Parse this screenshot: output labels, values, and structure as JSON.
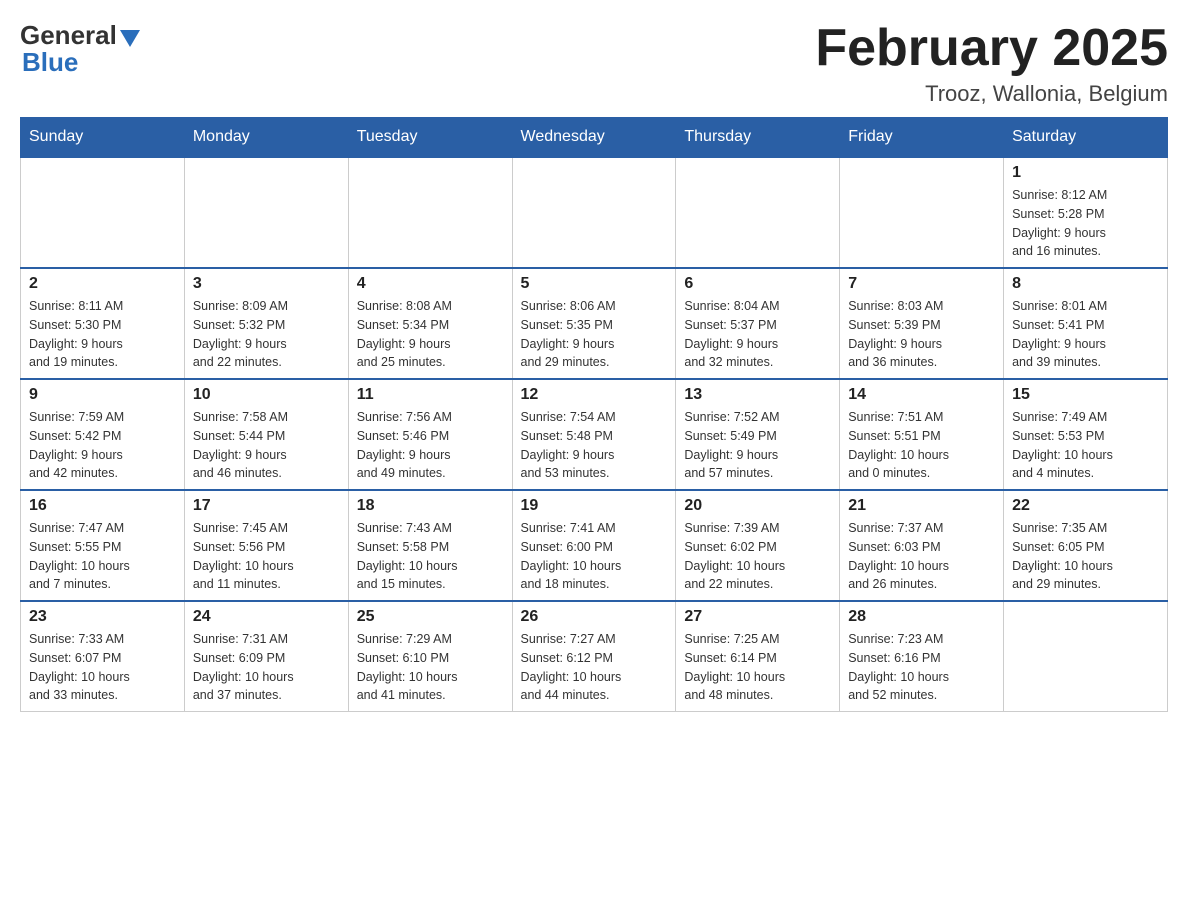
{
  "header": {
    "logo_general": "General",
    "logo_blue": "Blue",
    "month_title": "February 2025",
    "location": "Trooz, Wallonia, Belgium"
  },
  "weekdays": [
    "Sunday",
    "Monday",
    "Tuesday",
    "Wednesday",
    "Thursday",
    "Friday",
    "Saturday"
  ],
  "weeks": [
    {
      "days": [
        {
          "num": "",
          "info": ""
        },
        {
          "num": "",
          "info": ""
        },
        {
          "num": "",
          "info": ""
        },
        {
          "num": "",
          "info": ""
        },
        {
          "num": "",
          "info": ""
        },
        {
          "num": "",
          "info": ""
        },
        {
          "num": "1",
          "info": "Sunrise: 8:12 AM\nSunset: 5:28 PM\nDaylight: 9 hours\nand 16 minutes."
        }
      ]
    },
    {
      "days": [
        {
          "num": "2",
          "info": "Sunrise: 8:11 AM\nSunset: 5:30 PM\nDaylight: 9 hours\nand 19 minutes."
        },
        {
          "num": "3",
          "info": "Sunrise: 8:09 AM\nSunset: 5:32 PM\nDaylight: 9 hours\nand 22 minutes."
        },
        {
          "num": "4",
          "info": "Sunrise: 8:08 AM\nSunset: 5:34 PM\nDaylight: 9 hours\nand 25 minutes."
        },
        {
          "num": "5",
          "info": "Sunrise: 8:06 AM\nSunset: 5:35 PM\nDaylight: 9 hours\nand 29 minutes."
        },
        {
          "num": "6",
          "info": "Sunrise: 8:04 AM\nSunset: 5:37 PM\nDaylight: 9 hours\nand 32 minutes."
        },
        {
          "num": "7",
          "info": "Sunrise: 8:03 AM\nSunset: 5:39 PM\nDaylight: 9 hours\nand 36 minutes."
        },
        {
          "num": "8",
          "info": "Sunrise: 8:01 AM\nSunset: 5:41 PM\nDaylight: 9 hours\nand 39 minutes."
        }
      ]
    },
    {
      "days": [
        {
          "num": "9",
          "info": "Sunrise: 7:59 AM\nSunset: 5:42 PM\nDaylight: 9 hours\nand 42 minutes."
        },
        {
          "num": "10",
          "info": "Sunrise: 7:58 AM\nSunset: 5:44 PM\nDaylight: 9 hours\nand 46 minutes."
        },
        {
          "num": "11",
          "info": "Sunrise: 7:56 AM\nSunset: 5:46 PM\nDaylight: 9 hours\nand 49 minutes."
        },
        {
          "num": "12",
          "info": "Sunrise: 7:54 AM\nSunset: 5:48 PM\nDaylight: 9 hours\nand 53 minutes."
        },
        {
          "num": "13",
          "info": "Sunrise: 7:52 AM\nSunset: 5:49 PM\nDaylight: 9 hours\nand 57 minutes."
        },
        {
          "num": "14",
          "info": "Sunrise: 7:51 AM\nSunset: 5:51 PM\nDaylight: 10 hours\nand 0 minutes."
        },
        {
          "num": "15",
          "info": "Sunrise: 7:49 AM\nSunset: 5:53 PM\nDaylight: 10 hours\nand 4 minutes."
        }
      ]
    },
    {
      "days": [
        {
          "num": "16",
          "info": "Sunrise: 7:47 AM\nSunset: 5:55 PM\nDaylight: 10 hours\nand 7 minutes."
        },
        {
          "num": "17",
          "info": "Sunrise: 7:45 AM\nSunset: 5:56 PM\nDaylight: 10 hours\nand 11 minutes."
        },
        {
          "num": "18",
          "info": "Sunrise: 7:43 AM\nSunset: 5:58 PM\nDaylight: 10 hours\nand 15 minutes."
        },
        {
          "num": "19",
          "info": "Sunrise: 7:41 AM\nSunset: 6:00 PM\nDaylight: 10 hours\nand 18 minutes."
        },
        {
          "num": "20",
          "info": "Sunrise: 7:39 AM\nSunset: 6:02 PM\nDaylight: 10 hours\nand 22 minutes."
        },
        {
          "num": "21",
          "info": "Sunrise: 7:37 AM\nSunset: 6:03 PM\nDaylight: 10 hours\nand 26 minutes."
        },
        {
          "num": "22",
          "info": "Sunrise: 7:35 AM\nSunset: 6:05 PM\nDaylight: 10 hours\nand 29 minutes."
        }
      ]
    },
    {
      "days": [
        {
          "num": "23",
          "info": "Sunrise: 7:33 AM\nSunset: 6:07 PM\nDaylight: 10 hours\nand 33 minutes."
        },
        {
          "num": "24",
          "info": "Sunrise: 7:31 AM\nSunset: 6:09 PM\nDaylight: 10 hours\nand 37 minutes."
        },
        {
          "num": "25",
          "info": "Sunrise: 7:29 AM\nSunset: 6:10 PM\nDaylight: 10 hours\nand 41 minutes."
        },
        {
          "num": "26",
          "info": "Sunrise: 7:27 AM\nSunset: 6:12 PM\nDaylight: 10 hours\nand 44 minutes."
        },
        {
          "num": "27",
          "info": "Sunrise: 7:25 AM\nSunset: 6:14 PM\nDaylight: 10 hours\nand 48 minutes."
        },
        {
          "num": "28",
          "info": "Sunrise: 7:23 AM\nSunset: 6:16 PM\nDaylight: 10 hours\nand 52 minutes."
        },
        {
          "num": "",
          "info": ""
        }
      ]
    }
  ]
}
